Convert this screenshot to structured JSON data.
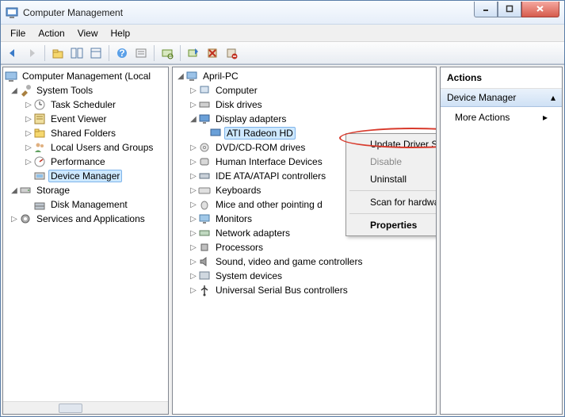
{
  "window": {
    "title": "Computer Management"
  },
  "menu": {
    "file": "File",
    "action": "Action",
    "view": "View",
    "help": "Help"
  },
  "left_tree": {
    "root": "Computer Management (Local",
    "system_tools": "System Tools",
    "task_scheduler": "Task Scheduler",
    "event_viewer": "Event Viewer",
    "shared_folders": "Shared Folders",
    "local_users": "Local Users and Groups",
    "performance": "Performance",
    "device_manager": "Device Manager",
    "storage": "Storage",
    "disk_management": "Disk Management",
    "services_apps": "Services and Applications"
  },
  "mid_tree": {
    "root": "April-PC",
    "computer": "Computer",
    "disk_drives": "Disk drives",
    "display_adapters": "Display adapters",
    "ati": "ATI Radeon HD",
    "dvd": "DVD/CD-ROM drives",
    "hid": "Human Interface Devices",
    "ide": "IDE ATA/ATAPI controllers",
    "keyboards": "Keyboards",
    "mice": "Mice and other pointing d",
    "monitors": "Monitors",
    "network": "Network adapters",
    "processors": "Processors",
    "sound": "Sound, video and game controllers",
    "system_devices": "System devices",
    "usb": "Universal Serial Bus controllers"
  },
  "actions": {
    "header": "Actions",
    "section": "Device Manager",
    "more": "More Actions"
  },
  "ctx": {
    "update": "Update Driver Software...",
    "disable": "Disable",
    "uninstall": "Uninstall",
    "scan": "Scan for hardware changes",
    "properties": "Properties"
  }
}
